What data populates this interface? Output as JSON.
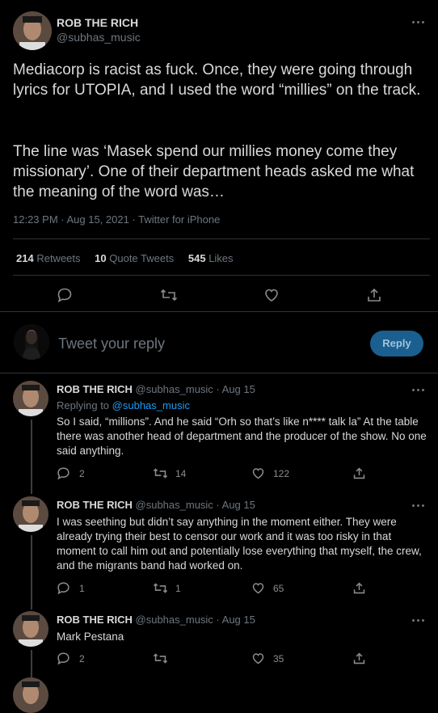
{
  "main_tweet": {
    "name": "ROB THE RICH",
    "handle": "@subhas_music",
    "paragraph1": "Mediacorp is racist as fuck. Once, they were going through lyrics for UTOPIA, and I used the word “millies” on the track.",
    "paragraph2": "The line was ‘Masek spend our millies money come they missionary’. One of their department heads asked me what the meaning of the word was…",
    "meta": "12:23 PM · Aug 15, 2021 · Twitter for iPhone",
    "stats": {
      "retweets_count": "214",
      "retweets_label": "Retweets",
      "quotes_count": "10",
      "quotes_label": "Quote Tweets",
      "likes_count": "545",
      "likes_label": "Likes"
    }
  },
  "composer": {
    "placeholder": "Tweet your reply",
    "button_label": "Reply"
  },
  "replies": [
    {
      "name": "ROB THE RICH",
      "handle_date": "@subhas_music · Aug 15",
      "replying_prefix": "Replying to",
      "replying_handle": "@subhas_music",
      "text": "So I said, “millions”. And he said “Orh so that’s like n**** talk la” At the table there was another head of department and the producer of the show. No one said anything.",
      "replies": "2",
      "retweets": "14",
      "likes": "122"
    },
    {
      "name": "ROB THE RICH",
      "handle_date": "@subhas_music · Aug 15",
      "text": "I was seething but didn’t say anything in the moment either. They were already trying their best to censor our work and it was too risky in that moment to call him out and potentially lose everything that myself, the crew, and the migrants band had worked on.",
      "replies": "1",
      "retweets": "1",
      "likes": "65"
    },
    {
      "name": "ROB THE RICH",
      "handle_date": "@subhas_music · Aug 15",
      "text": "Mark Pestana",
      "replies": "2",
      "retweets": "",
      "likes": "35"
    }
  ],
  "colors": {
    "background": "#000000",
    "link": "#1d9bf0",
    "reply_button": "#1a5f8f",
    "divider": "#2f3336"
  },
  "icons": [
    "more-icon",
    "reply-icon",
    "retweet-icon",
    "like-icon",
    "share-icon"
  ]
}
